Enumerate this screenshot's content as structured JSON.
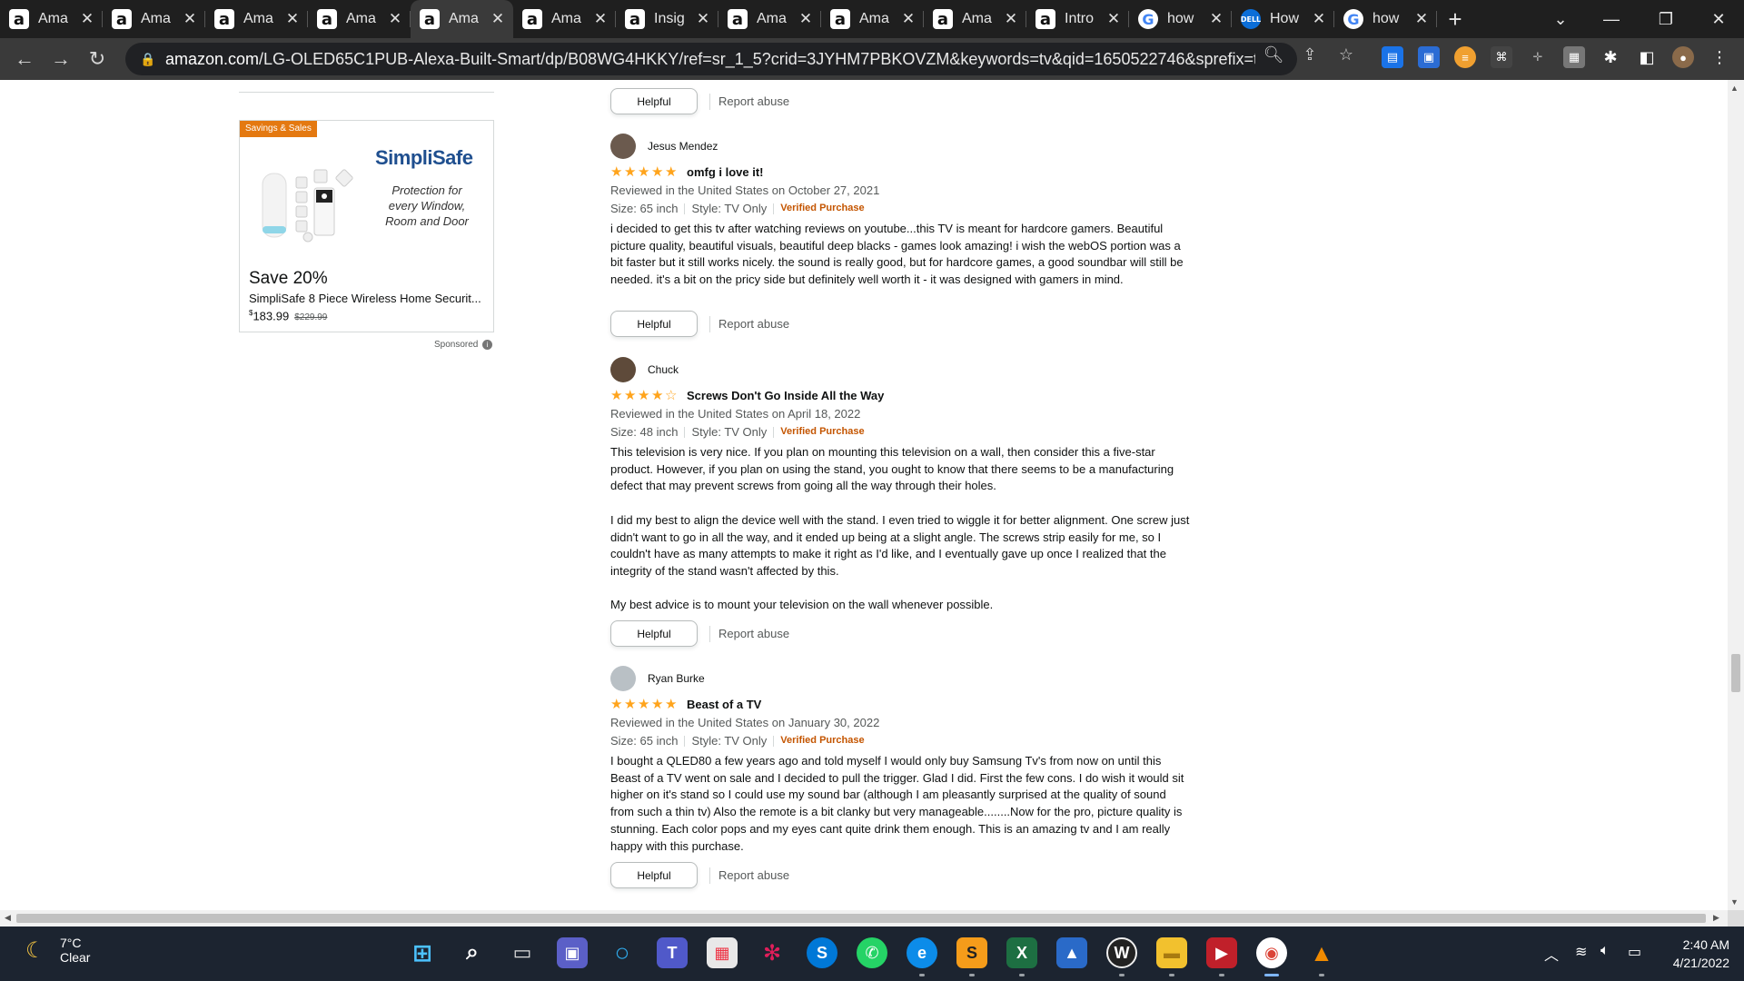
{
  "browser": {
    "tabs": [
      {
        "title": "Ama",
        "favicon": "amazon-icon",
        "active": false
      },
      {
        "title": "Ama",
        "favicon": "amazon-icon",
        "active": false
      },
      {
        "title": "Ama",
        "favicon": "amazon-icon",
        "active": false
      },
      {
        "title": "Ama",
        "favicon": "amazon-icon",
        "active": false
      },
      {
        "title": "Ama",
        "favicon": "amazon-icon",
        "active": true
      },
      {
        "title": "Ama",
        "favicon": "amazon-icon",
        "active": false
      },
      {
        "title": "Insig",
        "favicon": "amazon-icon",
        "active": false
      },
      {
        "title": "Ama",
        "favicon": "amazon-icon",
        "active": false
      },
      {
        "title": "Ama",
        "favicon": "amazon-icon",
        "active": false
      },
      {
        "title": "Ama",
        "favicon": "amazon-icon",
        "active": false
      },
      {
        "title": "Intro",
        "favicon": "amazon-icon",
        "active": false
      },
      {
        "title": "how",
        "favicon": "google-icon",
        "active": false
      },
      {
        "title": "How",
        "favicon": "dell-icon",
        "active": false
      },
      {
        "title": "how",
        "favicon": "google-icon",
        "active": false
      }
    ],
    "url_host": "amazon.com",
    "url_path": "/LG-OLED65C1PUB-Alexa-Built-Smart/dp/B08WG4HKKY/ref=sr_1_5?crid=3JYHM7PBKOVZM&keywords=tv&qid=1650522746&sprefix=tv%2..."
  },
  "ad": {
    "badge": "Savings & Sales",
    "brand": "SimpliSafe",
    "tagline": "Protection for every Window, Room and Door",
    "save": "Save 20%",
    "product_name": "SimpliSafe 8 Piece Wireless Home Securit...",
    "price_symbol": "$",
    "price": "183.99",
    "list_price": "$229.99",
    "sponsored": "Sponsored"
  },
  "buttons": {
    "helpful": "Helpful",
    "report": "Report abuse"
  },
  "reviews": [
    {
      "name": "Jesus Mendez",
      "rating": 5,
      "title": "omfg i love it!",
      "meta": "Reviewed in the United States on October 27, 2021",
      "size": "Size: 65 inch",
      "style": "Style: TV Only",
      "verified": "Verified Purchase",
      "body": [
        "i decided to get this tv after watching reviews on youtube...this TV is meant for hardcore gamers. Beautiful picture quality, beautiful visuals, beautiful deep blacks - games look amazing! i wish the webOS portion was a bit faster but it still works nicely. the sound is really good, but for hardcore games, a good soundbar will still be needed. it's a bit on the pricy side but definitely well worth it - it was designed with gamers in mind."
      ],
      "avatar_color": "#6b5a4e"
    },
    {
      "name": "Chuck",
      "rating": 4,
      "title": "Screws Don't Go Inside All the Way",
      "meta": "Reviewed in the United States on April 18, 2022",
      "size": "Size: 48 inch",
      "style": "Style: TV Only",
      "verified": "Verified Purchase",
      "body": [
        "This television is very nice. If you plan on mounting this television on a wall, then consider this a five-star product. However, if you plan on using the stand, you ought to know that there seems to be a manufacturing defect that may prevent screws from going all the way through their holes.",
        "I did my best to align the device well with the stand. I even tried to wiggle it for better alignment. One screw just didn't want to go in all the way, and it ended up being at a slight angle. The screws strip easily for me, so I couldn't have as many attempts to make it right as I'd like, and I eventually gave up once I realized that the integrity of the stand wasn't affected by this.",
        "My best advice is to mount your television on the wall whenever possible."
      ],
      "avatar_color": "#5e4a3a"
    },
    {
      "name": "Ryan Burke",
      "rating": 5,
      "title": "Beast of a TV",
      "meta": "Reviewed in the United States on January 30, 2022",
      "size": "Size: 65 inch",
      "style": "Style: TV Only",
      "verified": "Verified Purchase",
      "body": [
        "I bought a QLED80 a few years ago and told myself I would only buy Samsung Tv's from now on until this Beast of a TV went on sale and I decided to pull the trigger. Glad I did. First the few cons. I do wish it would sit higher on it's stand so I could use my sound bar (although I am pleasantly surprised at the quality of sound from such a thin tv) Also the remote is a bit clanky but very manageable........Now for the pro, picture quality is stunning. Each color pops and my eyes cant quite drink them enough. This is an amazing tv and I am really happy with this purchase."
      ],
      "avatar_color": "#b9c0c5"
    }
  ],
  "taskbar": {
    "temperature": "7°C",
    "condition": "Clear",
    "time": "2:40 AM",
    "date": "4/21/2022"
  }
}
